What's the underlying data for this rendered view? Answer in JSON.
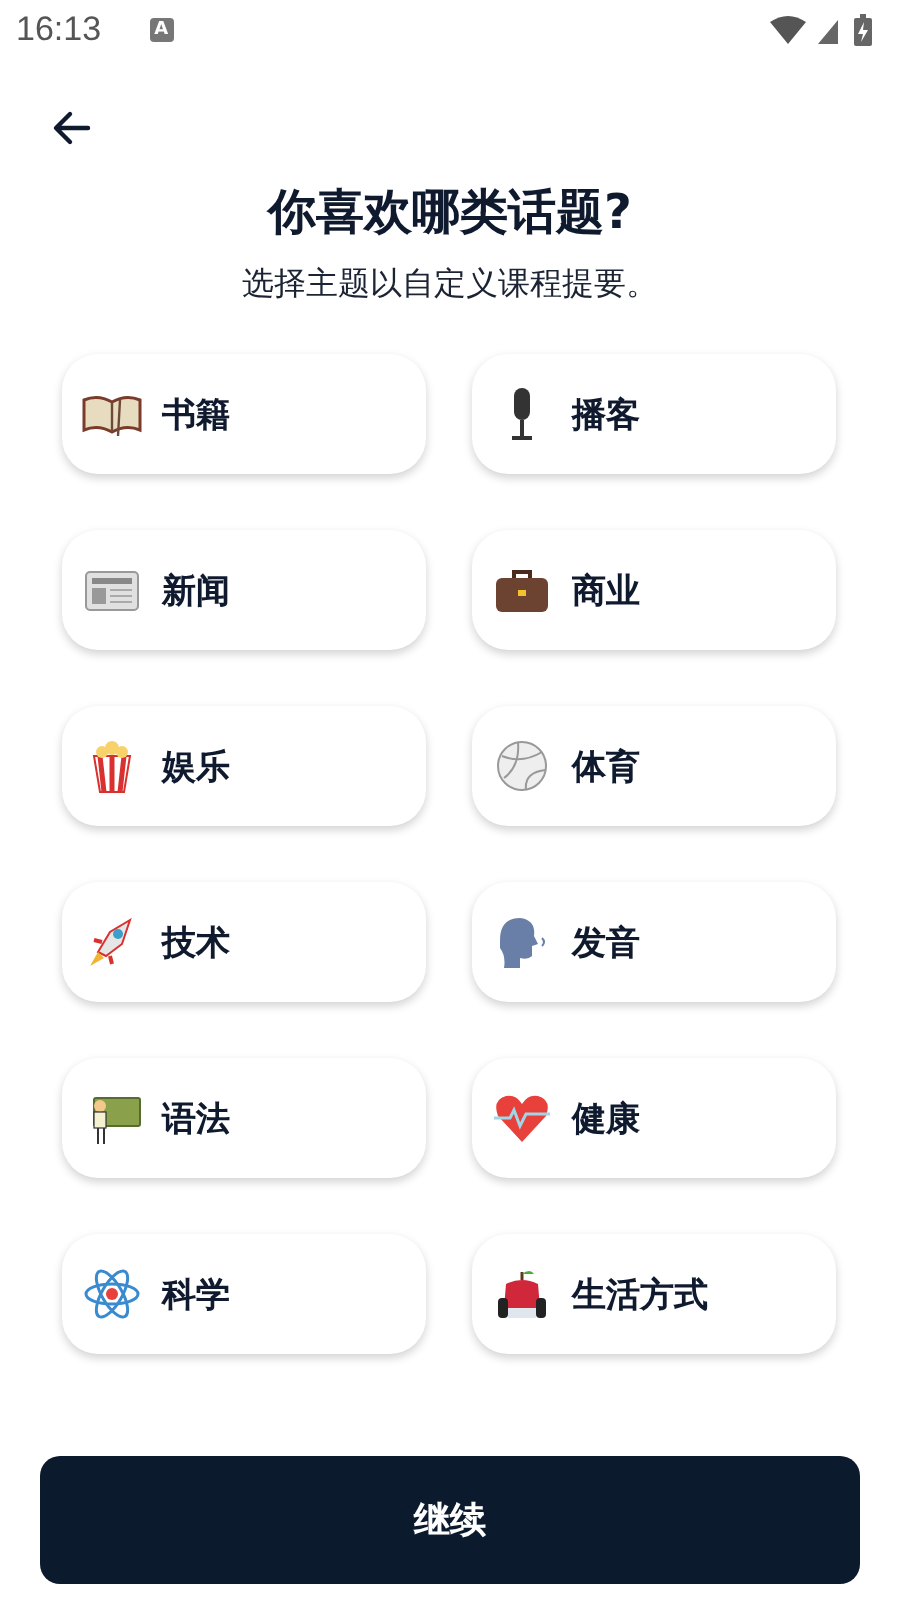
{
  "status_bar": {
    "time": "16:13",
    "notification": "A"
  },
  "title": "你喜欢哪类话题?",
  "subtitle": "选择主题以自定义课程提要。",
  "topics": [
    {
      "label": "书籍"
    },
    {
      "label": "播客"
    },
    {
      "label": "新闻"
    },
    {
      "label": "商业"
    },
    {
      "label": "娱乐"
    },
    {
      "label": "体育"
    },
    {
      "label": "技术"
    },
    {
      "label": "发音"
    },
    {
      "label": "语法"
    },
    {
      "label": "健康"
    },
    {
      "label": "科学"
    },
    {
      "label": "生活方式"
    }
  ],
  "continue_button": "继续"
}
